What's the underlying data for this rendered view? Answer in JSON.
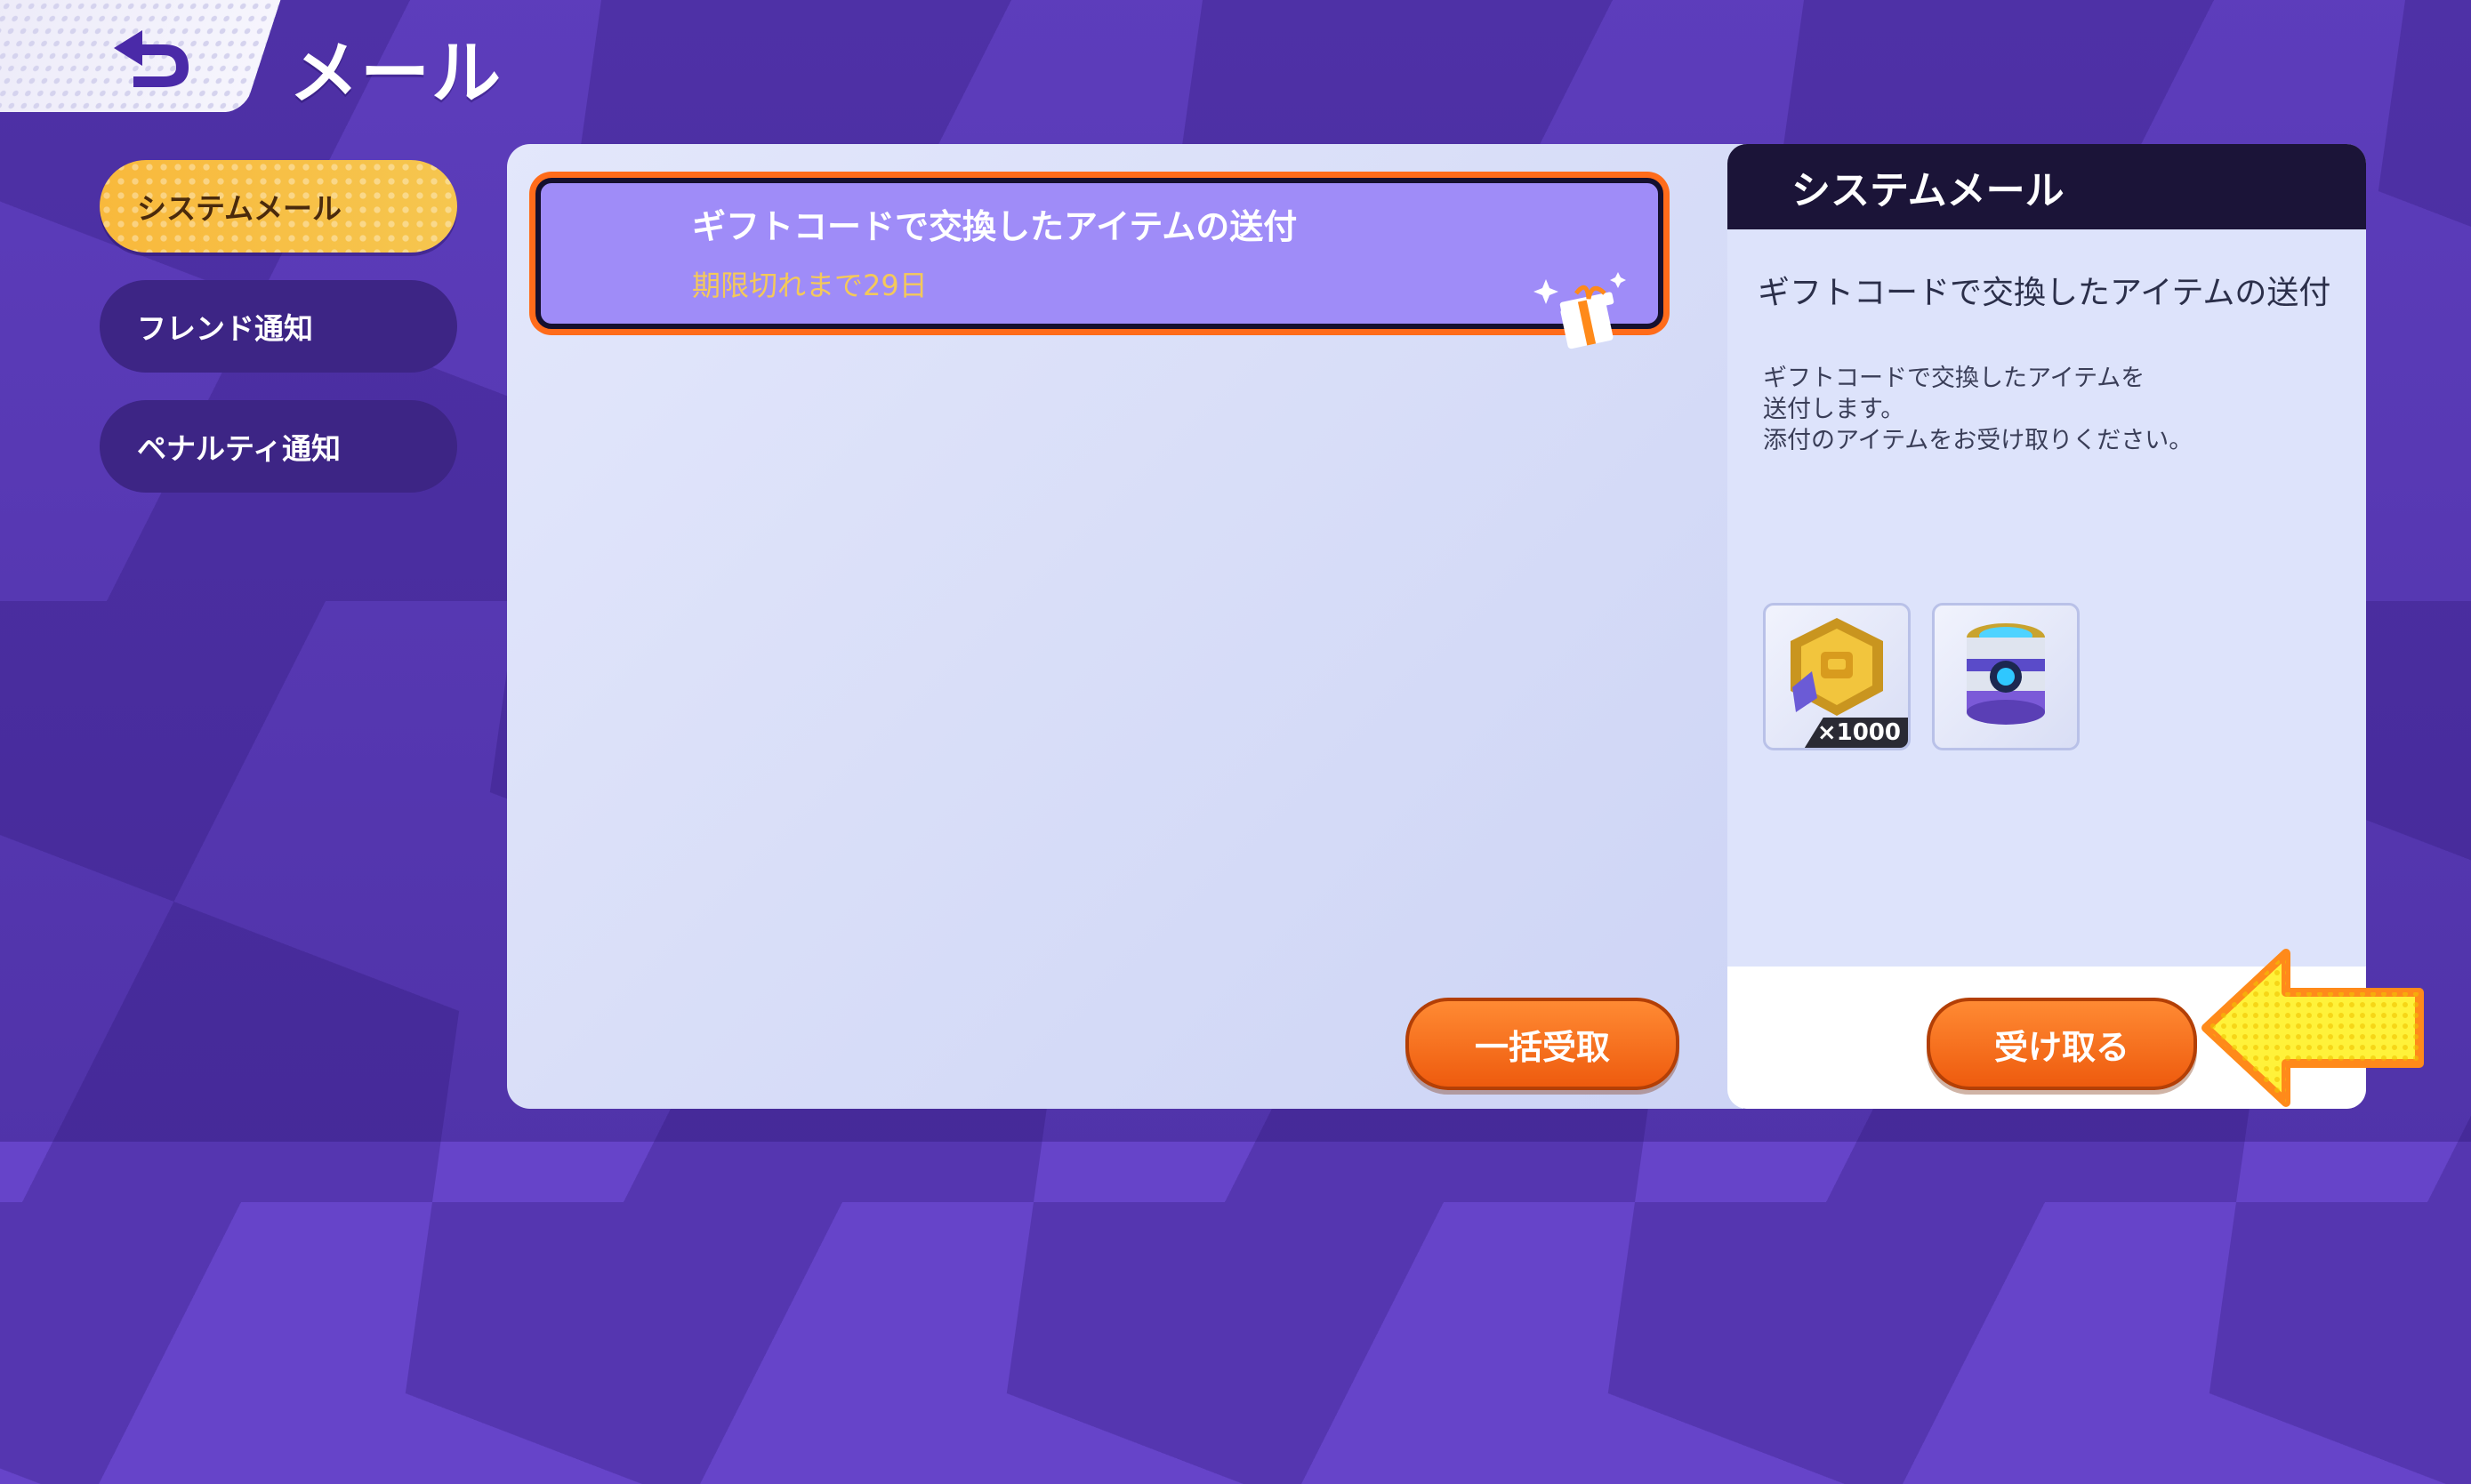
{
  "header": {
    "title": "メール"
  },
  "sidebar": {
    "items": [
      {
        "label": "システムメール",
        "active": true
      },
      {
        "label": "フレンド通知",
        "active": false
      },
      {
        "label": "ペナルティ通知",
        "active": false
      }
    ]
  },
  "mail_list": {
    "items": [
      {
        "subject": "ギフトコードで交換したアイテムの送付",
        "expiry": "期限切れまで29日",
        "icon": "gift-icon"
      }
    ],
    "bulk_receive_label": "一括受取"
  },
  "detail": {
    "header_title": "システムメール",
    "subject": "ギフトコードで交換したアイテムの送付",
    "body_lines": [
      "ギフトコードで交換したアイテムを",
      "送付します。",
      "添付のアイテムをお受け取りください。"
    ],
    "attachments": [
      {
        "icon": "coin-ticket-icon",
        "quantity": "×1000"
      },
      {
        "icon": "item-capsule-icon",
        "quantity": ""
      }
    ],
    "receive_label": "受け取る"
  },
  "colors": {
    "accent": "#ff6b1a",
    "active_tab": "#f8b93c",
    "background": "#5a3bb8"
  }
}
